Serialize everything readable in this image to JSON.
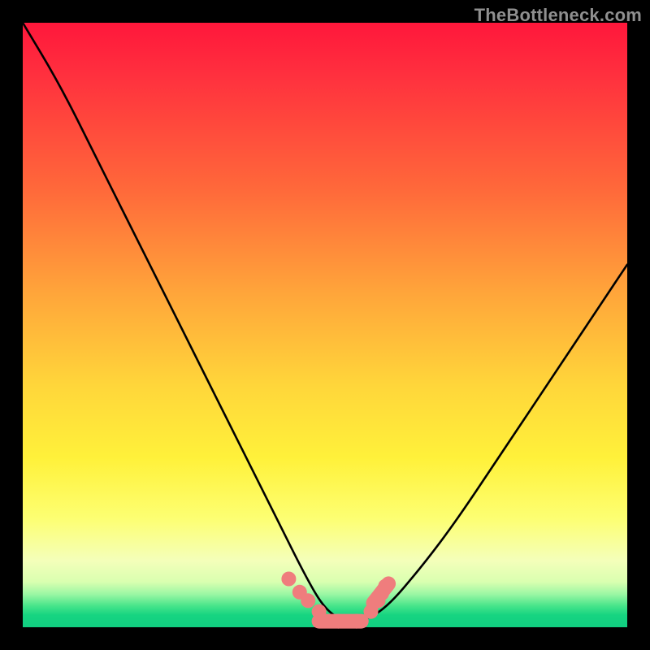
{
  "watermark": "TheBottleneck.com",
  "chart_data": {
    "type": "line",
    "title": "",
    "xlabel": "",
    "ylabel": "",
    "xlim": [
      0,
      100
    ],
    "ylim": [
      0,
      100
    ],
    "series": [
      {
        "name": "bottleneck-curve",
        "x": [
          0,
          6,
          12,
          20,
          28,
          36,
          42,
          47,
          50,
          53,
          56,
          60,
          66,
          72,
          80,
          88,
          96,
          100
        ],
        "y": [
          100,
          90,
          78,
          62,
          46,
          30,
          18,
          8,
          3,
          1,
          1,
          3,
          10,
          18,
          30,
          42,
          54,
          60
        ]
      }
    ],
    "markers": {
      "name": "highlight-points",
      "x": [
        44.0,
        45.8,
        47.2,
        49.0,
        52.2,
        55.2,
        57.6,
        58.8,
        59.4,
        60.0
      ],
      "y": [
        8.0,
        5.8,
        4.4,
        2.6,
        1.0,
        1.0,
        2.6,
        4.4,
        5.6,
        6.8
      ]
    },
    "gradient_stops": [
      {
        "pos": 0.0,
        "color": "#ff173b"
      },
      {
        "pos": 0.28,
        "color": "#ff6a3a"
      },
      {
        "pos": 0.6,
        "color": "#ffd63a"
      },
      {
        "pos": 0.82,
        "color": "#fdff72"
      },
      {
        "pos": 0.96,
        "color": "#46e48a"
      },
      {
        "pos": 1.0,
        "color": "#11cf81"
      }
    ]
  }
}
